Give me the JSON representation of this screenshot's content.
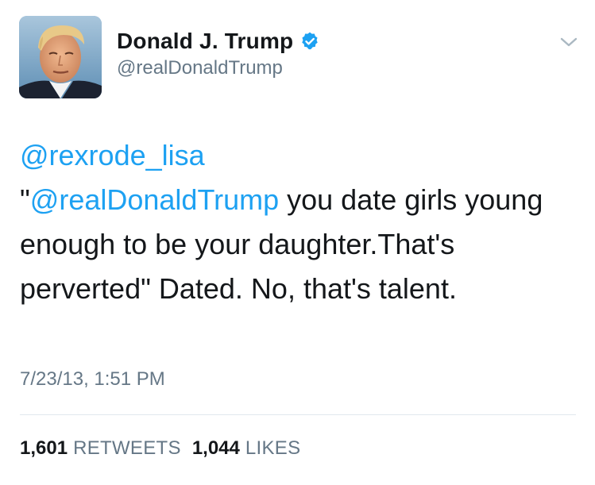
{
  "user": {
    "name": "Donald J. Trump",
    "handle": "@realDonaldTrump",
    "verified": true,
    "avatar_icon": "profile-photo"
  },
  "tweet": {
    "reply_to": "@rexrode_lisa",
    "quote_open": "\"",
    "mention": "@realDonaldTrump",
    "body": " you date girls young enough to be your daughter.That's perverted\" Dated. No, that's talent.",
    "timestamp": "7/23/13, 1:51 PM"
  },
  "stats": {
    "retweets_count": "1,601",
    "retweets_label": "RETWEETS",
    "likes_count": "1,044",
    "likes_label": "LIKES"
  },
  "colors": {
    "link": "#1da1f2",
    "secondary_text": "#657786",
    "primary_text": "#14171a",
    "verified_badge": "#1da1f2",
    "divider": "#e1e8ed"
  },
  "icons": {
    "verified": "verified-badge-icon",
    "more": "chevron-down-icon"
  }
}
